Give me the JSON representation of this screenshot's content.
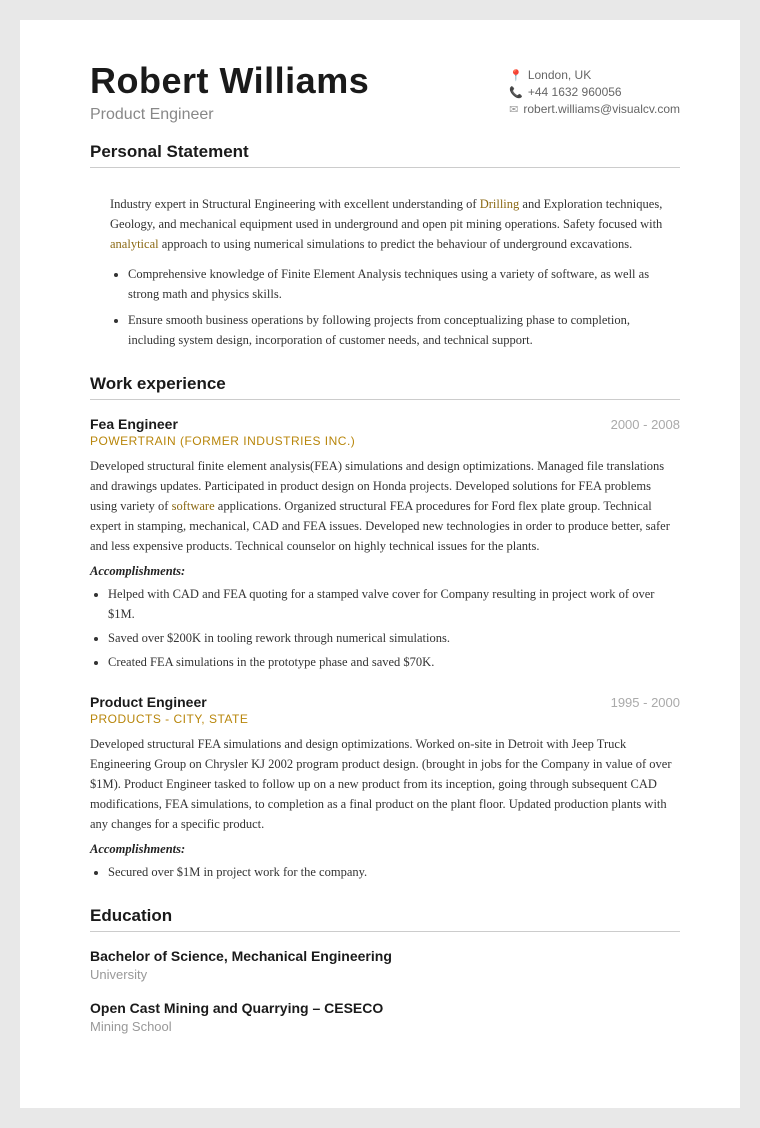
{
  "header": {
    "name": "Robert Williams",
    "title": "Product Engineer",
    "contact": {
      "location": "London, UK",
      "phone": "+44 1632 960056",
      "email": "robert.williams@visualcv.com"
    }
  },
  "sections": {
    "personal_statement": {
      "title": "Personal Statement",
      "intro": "Industry expert in Structural Engineering with excellent understanding of Drilling and Exploration techniques, Geology, and mechanical equipment used in underground and open pit mining operations. Safety focused with analytical approach to using numerical simulations to predict the behaviour of underground excavations.",
      "bullets": [
        "Comprehensive knowledge of Finite Element Analysis techniques using a variety of software, as well as strong math and physics skills.",
        "Ensure smooth business operations by following projects from conceptualizing phase to completion, including system design, incorporation of customer needs, and technical support."
      ]
    },
    "work_experience": {
      "title": "Work experience",
      "jobs": [
        {
          "title": "Fea Engineer",
          "dates": "2000 - 2008",
          "company": "POWERTRAIN (FORMER INDUSTRIES INC.)",
          "description": "Developed structural finite element analysis(FEA) simulations and design optimizations. Managed file translations and drawings updates. Participated in product design on Honda projects. Developed solutions for FEA problems using variety of software applications. Organized structural FEA procedures for Ford flex plate group. Technical expert in stamping, mechanical, CAD and FEA issues. Developed new technologies in order to produce better, safer and less expensive products. Technical counselor on highly technical issues for the plants.",
          "accomplishments_label": "Accomplishments:",
          "accomplishments": [
            "Helped with CAD and FEA quoting for a stamped valve cover for Company resulting in project work of over $1M.",
            "Saved over $200K in tooling rework through numerical simulations.",
            "Created FEA simulations in the prototype phase and saved $70K."
          ]
        },
        {
          "title": "Product Engineer",
          "dates": "1995 - 2000",
          "company": "PRODUCTS - CITY, STATE",
          "description": "Developed structural FEA simulations and design optimizations. Worked on-site in Detroit with Jeep Truck Engineering Group on Chrysler KJ 2002 program product design. (brought in jobs for the Company in value of over $1M). Product Engineer tasked to follow up on a new product from its inception, going through subsequent CAD modifications, FEA simulations, to completion as a final product on the plant floor. Updated production plants with any changes for a specific product.",
          "accomplishments_label": "Accomplishments:",
          "accomplishments": [
            "Secured over $1M in project work for the company."
          ]
        }
      ]
    },
    "education": {
      "title": "Education",
      "items": [
        {
          "degree": "Bachelor of Science, Mechanical Engineering",
          "school": "University"
        },
        {
          "degree": "Open Cast Mining and Quarrying – CESECO",
          "school": "Mining School"
        }
      ]
    }
  }
}
